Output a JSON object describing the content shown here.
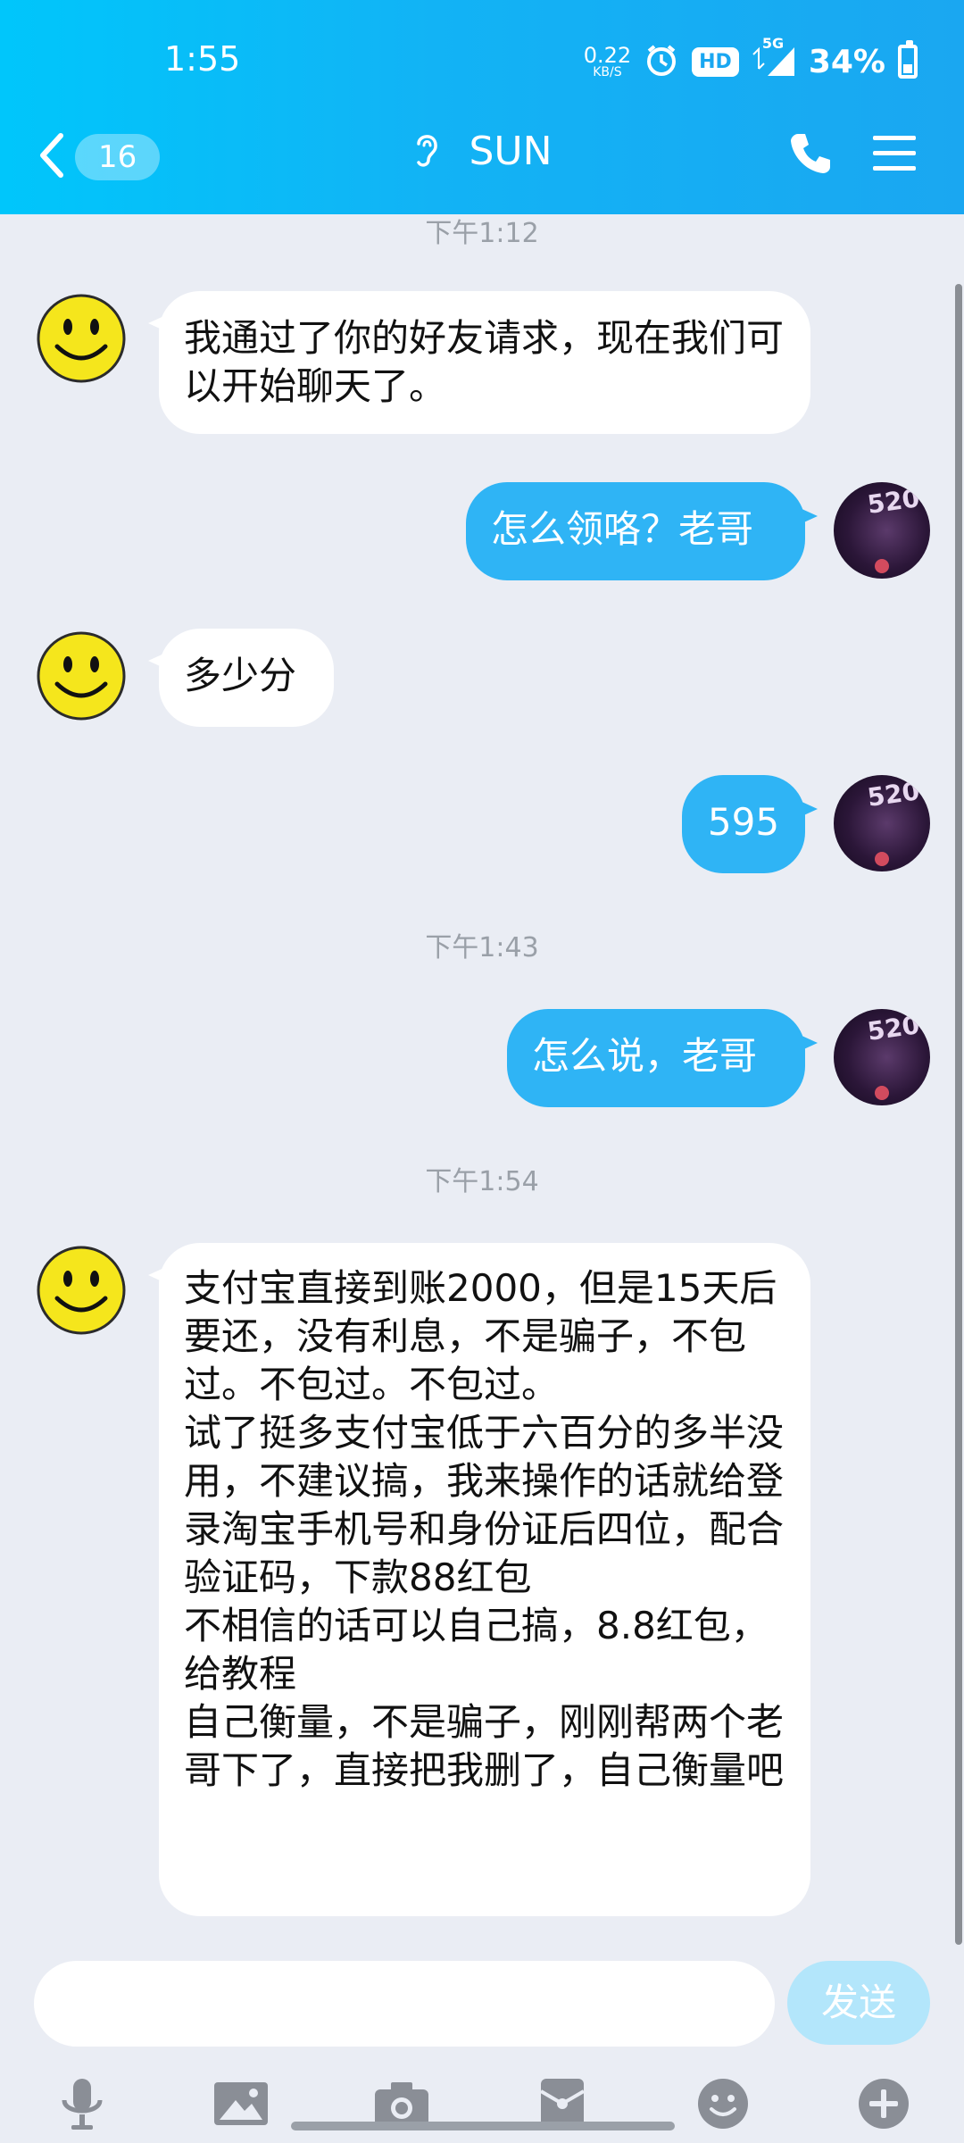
{
  "status_bar": {
    "time": "1:55",
    "net_speed": "0.22",
    "net_unit": "KB/S",
    "hd": "HD",
    "network": "5G",
    "battery": "34%"
  },
  "header": {
    "unread_count": "16",
    "contact_name": "SUN"
  },
  "timestamps": [
    "下午1:12",
    "下午1:43",
    "下午1:54"
  ],
  "messages": [
    {
      "side": "left",
      "text": "我通过了你的好友请求，现在我们可以开始聊天了。"
    },
    {
      "side": "right",
      "text": "怎么领咯？老哥"
    },
    {
      "side": "left",
      "text": "多少分"
    },
    {
      "side": "right",
      "text": "595"
    },
    {
      "side": "right",
      "text": "怎么说，老哥"
    },
    {
      "side": "left",
      "text": "支付宝直接到账2000，但是15天后要还，没有利息，不是骗子，不包过。不包过。不包过。\n试了挺多支付宝低于六百分的多半没用，不建议搞，我来操作的话就给登录淘宝手机号和身份证后四位，配合验证码，下款88红包\n不相信的话可以自己搞，8.8红包，给教程\n自己衡量，不是骗子，刚刚帮两个老哥下了，直接把我删了，自己衡量吧"
    }
  ],
  "my_avatar_text": "520",
  "input": {
    "value": "",
    "send_label": "发送"
  },
  "toolbar_icons": [
    "mic-icon",
    "image-icon",
    "camera-icon",
    "red-packet-icon",
    "emoji-icon",
    "plus-icon"
  ],
  "colors": {
    "header": "#12b3f5",
    "my_bubble": "#2fb4f5",
    "their_bubble": "#ffffff",
    "background": "#eaedf4"
  }
}
